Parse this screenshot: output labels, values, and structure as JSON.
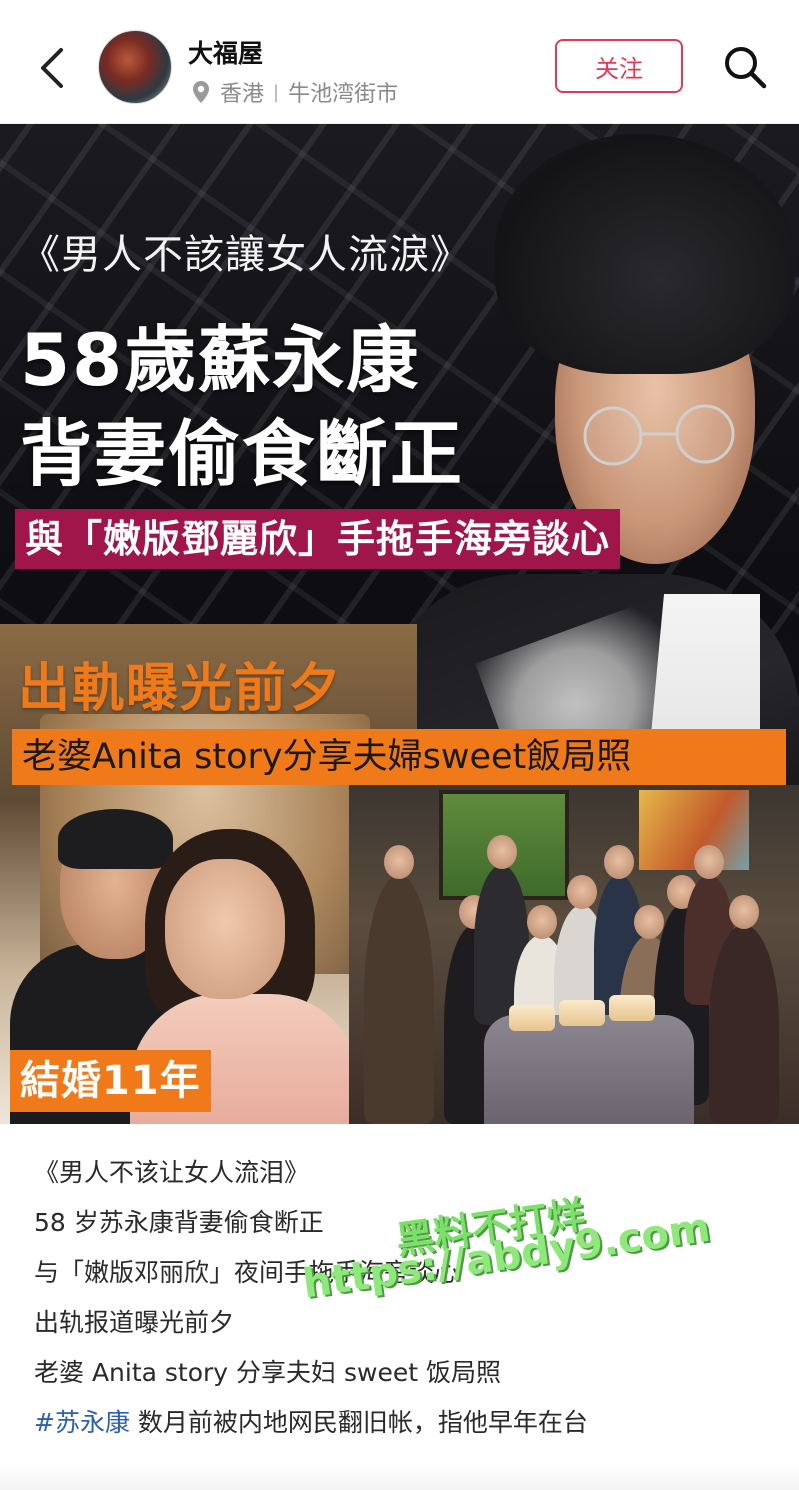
{
  "header": {
    "store_name": "大福屋",
    "location_region": "香港",
    "location_separator": "|",
    "location_place": "牛池湾街市",
    "follow_label": "关注"
  },
  "cover": {
    "quote_title": "《男人不該讓女人流淚》",
    "headline_line1": "58歲蘇永康",
    "headline_line2": "背妻偷食斷正",
    "tag_line": "與「嫩版鄧麗欣」手拖手海旁談心",
    "orange_title": "出軌曝光前夕",
    "orange_banner": "老婆Anita story分享夫婦sweet飯局照",
    "married_badge": "結婚11年"
  },
  "caption": {
    "line1": "《男人不该让女人流泪》",
    "line2": "58 岁苏永康背妻偷食断正",
    "line3": "与「嫩版邓丽欣」夜间手拖手海旁谈心",
    "line4": "出轨报道曝光前夕",
    "line5": "老婆 Anita story 分享夫妇 sweet 饭局照",
    "hashtag": "#苏永康",
    "line6_rest": " 数月前被内地网民翻旧帐，指他早年在台"
  },
  "watermark": {
    "line1": "黑料不打烊",
    "line2": "https://abdy9.com"
  },
  "colors": {
    "accent_red": "#e23a55",
    "tag_magenta": "#a0154a",
    "banner_orange": "#f07a1a",
    "hashtag_blue": "#2d5fb2",
    "watermark_green": "#8ee87a"
  },
  "icons": {
    "back": "chevron-left-icon",
    "location": "location-pin-icon",
    "search": "search-icon"
  }
}
